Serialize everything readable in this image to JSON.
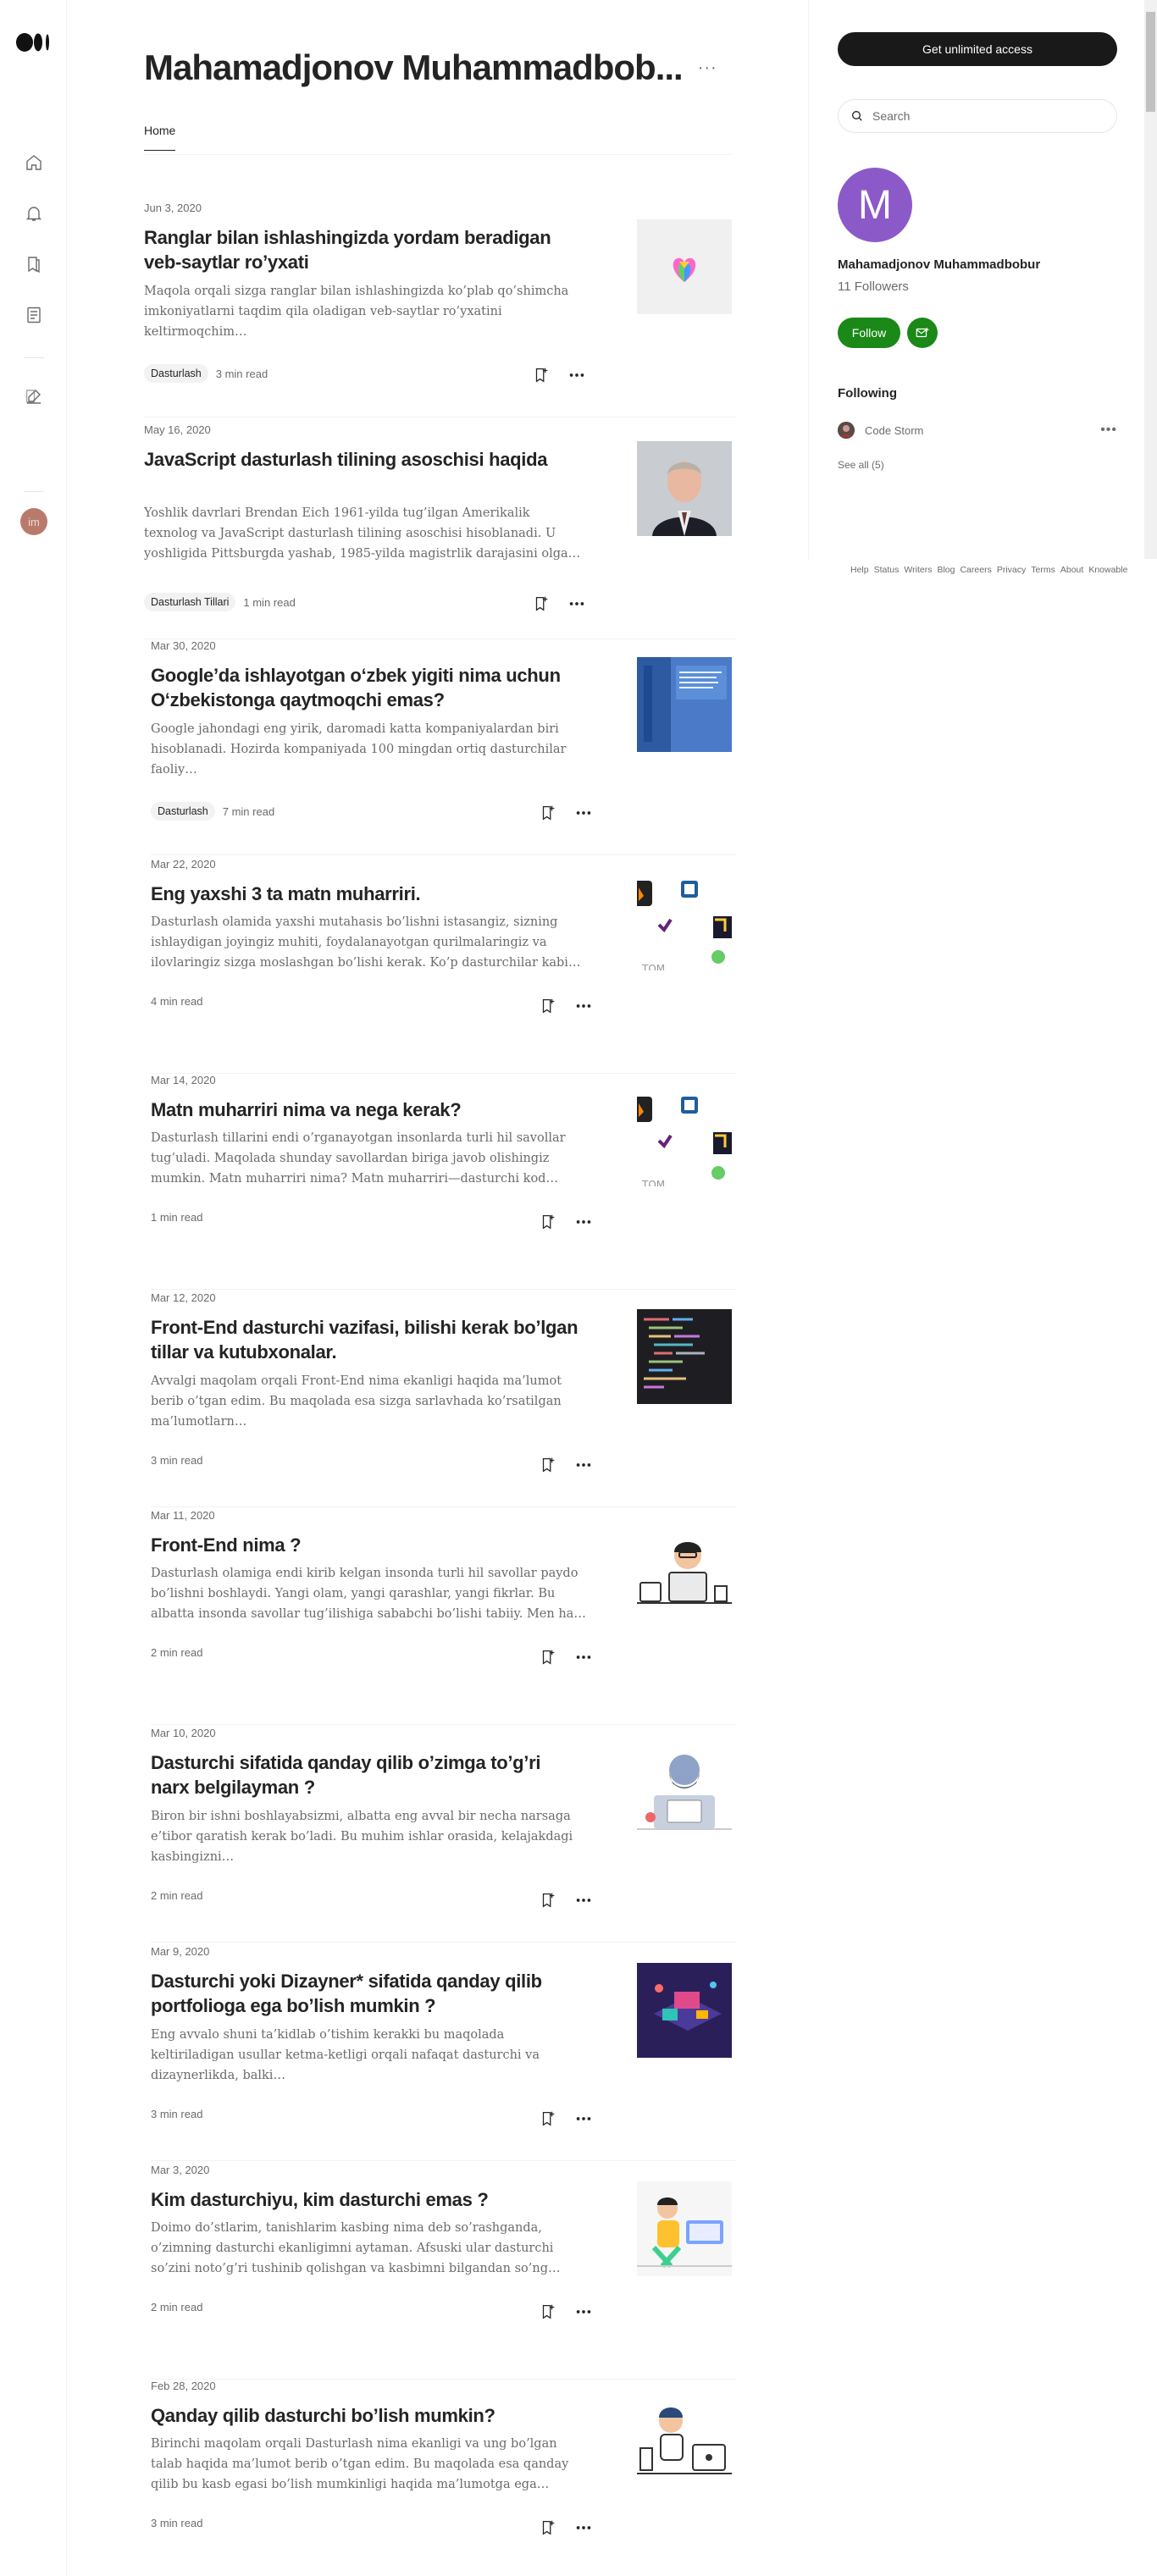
{
  "nav": {
    "icons": [
      "medium-logo-icon",
      "home-icon",
      "notifications-icon",
      "library-icon",
      "stories-icon",
      "write-icon"
    ],
    "avatar_initials": "im"
  },
  "profile": {
    "name": "Mahamadjonov Muhammadbob...",
    "more": "···",
    "tab_home": "Home"
  },
  "articles": [
    {
      "date": "Jun 3, 2020",
      "title": "Ranglar bilan ishlashingizda yordam beradigan veb-saytlar ro’yxati",
      "subtitle": "Maqola orqali sizga ranglar bilan ishlashingizda ko’plab qo’shimcha imkoniyatlarni taqdim qila oladigan veb-saytlar ro’yxatini keltirmoqchim…",
      "tag": "Dasturlash",
      "read": "3 min read"
    },
    {
      "date": "May 16, 2020",
      "title": "JavaScript dasturlash tilining asoschisi haqida",
      "subtitle": "Yoshlik davrlari Brendan Eich 1961-yilda tug’ilgan Amerikalik texnolog va JavaScript dasturlash tilining asoschisi hisoblanadi. U yoshligida Pittsburgda yashab, 1985-yilda magistrlik darajasini olgan. Eich o’zining…",
      "tag": "Dasturlash Tillari",
      "read": "1 min read"
    },
    {
      "date": "Mar 30, 2020",
      "title": "Google’da ishlayotgan o‘zbek yigiti nima uchun O‘zbekistonga qaytmoqchi emas?",
      "subtitle": "Google jahondagi eng yirik, daromadi katta kompaniyalardan biri hisoblanadi. Hozirda kompaniyada 100 mingdan ortiq dasturchilar faoliy…",
      "tag": "Dasturlash",
      "read": "7 min read"
    },
    {
      "date": "Mar 22, 2020",
      "title": "Eng yaxshi 3 ta matn muharriri.",
      "subtitle": "Dasturlash olamida yaxshi mutahasis bo’lishni istasangiz, sizning ishlaydigan joyingiz muhiti, foydalanayotgan qurilmalaringiz va ilovlaringiz sizga moslashgan bo’lishi kerak. Ko’p dasturchilar kabi men…",
      "tag": "",
      "read": "4 min read"
    },
    {
      "date": "Mar 14, 2020",
      "title": "Matn muharriri nima va nega kerak?",
      "subtitle": "Dasturlash tillarini endi o’rganayotgan insonlarda turli hil savollar tug’uladi. Maqolada shunday savollardan biriga javob olishingiz mumkin. Matn muharriri nima? Matn muharriri—dasturchi kod yozishi uchun…",
      "tag": "",
      "read": "1 min read"
    },
    {
      "date": "Mar 12, 2020",
      "title": "Front-End dasturchi vazifasi, bilishi kerak bo’lgan tillar va kutubxonalar.",
      "subtitle": "Avvalgi maqolam orqali Front-End nima ekanligi haqida ma’lumot berib o’tgan edim. Bu maqolada esa sizga sarlavhada ko’rsatilgan ma’lumotlarn…",
      "tag": "",
      "read": "3 min read"
    },
    {
      "date": "Mar 11, 2020",
      "title": "Front-End nima ?",
      "subtitle": "Dasturlash olamiga endi kirib kelgan insonda turli hil savollar paydo bo’lishni boshlaydi. Yangi olam, yangi qarashlar, yangi fikrlar. Bu albatta insonda savollar tug’ilishiga sababchi bo’lishi tabiiy. Men ham endi…",
      "tag": "",
      "read": "2 min read"
    },
    {
      "date": "Mar 10, 2020",
      "title": "Dasturchi sifatida qanday qilib o’zimga to’g’ri narx belgilayman ?",
      "subtitle": "Biron bir ishni boshlayabsizmi, albatta eng avval bir necha narsaga e’tibor qaratish kerak bo’ladi. Bu muhim ishlar orasida, kelajakdagi kasbingizni…",
      "tag": "",
      "read": "2 min read"
    },
    {
      "date": "Mar 9, 2020",
      "title": "Dasturchi yoki Dizayner* sifatida qanday qilib portfolioga ega bo’lish mumkin ?",
      "subtitle": "Eng avvalo shuni ta’kidlab o’tishim kerakki bu maqolada keltiriladigan usullar ketma-ketligi orqali nafaqat dasturchi va dizaynerlikda, balki…",
      "tag": "",
      "read": "3 min read"
    },
    {
      "date": "Mar 3, 2020",
      "title": "Kim dasturchiyu, kim dasturchi emas ?",
      "subtitle": "Doimo do’stlarim, tanishlarim kasbing nima deb so’rashganda, o’zimning dasturchi ekanligimni aytaman. Afsuski ular dasturchi so’zini noto’g’ri tushinib qolishgan va kasbimni bilgandan so’ng mendan turli hil ishlarni…",
      "tag": "",
      "read": "2 min read"
    },
    {
      "date": "Feb 28, 2020",
      "title": "Qanday qilib dasturchi bo’lish mumkin?",
      "subtitle": "Birinchi maqolam orqali Dasturlash nima ekanligi va ung bo’lgan talab haqida ma’lumot berib o’tgan edim. Bu maqolada esa qanday qilib bu kasb egasi bo’lish mumkinligi haqida ma’lumotga ega bo’lishingiz mumkin.…",
      "tag": "",
      "read": "3 min read"
    }
  ],
  "sidebar": {
    "cta": "Get unlimited access",
    "search_placeholder": "Search",
    "avatar_letter": "M",
    "name": "Mahamadjonov Muhammadbobur",
    "followers": "11 Followers",
    "follow": "Follow",
    "following_heading": "Following",
    "following": [
      {
        "name": "Code Storm"
      }
    ],
    "see_all": "See all (5)",
    "footer": [
      "Help",
      "Status",
      "Writers",
      "Blog",
      "Careers",
      "Privacy",
      "Terms",
      "About",
      "Knowable"
    ]
  },
  "colors": {
    "follow_green": "#1a8917",
    "avatar_purple": "#8c5ac8",
    "cta_black": "#191919"
  }
}
